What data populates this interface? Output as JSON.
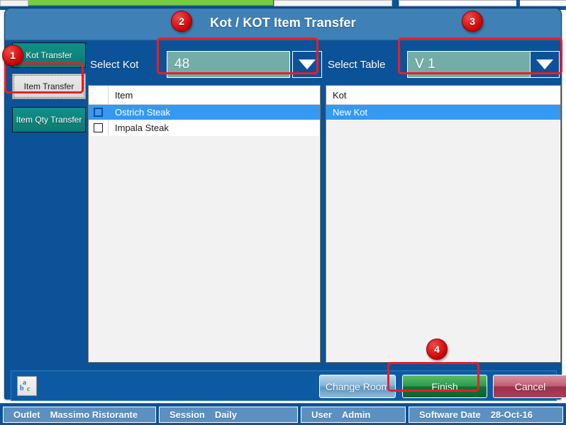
{
  "window": {
    "title": "Kot / KOT Item Transfer"
  },
  "sidebar": {
    "items": [
      {
        "label": "Kot Transfer",
        "state": "normal"
      },
      {
        "label": "Item Transfer",
        "state": "selected"
      },
      {
        "label": "Item Qty Transfer",
        "state": "normal"
      }
    ]
  },
  "fields": {
    "select_kot": {
      "label": "Select Kot",
      "value": "48",
      "dropdown_icon": "chevron-down-icon"
    },
    "select_table": {
      "label": "Select Table",
      "value": "V 1",
      "dropdown_icon": "chevron-down-icon"
    }
  },
  "item_list": {
    "header": "Item",
    "rows": [
      {
        "label": "Ostrich Steak",
        "checked": false,
        "selected": true
      },
      {
        "label": "Impala Steak",
        "checked": false,
        "selected": false
      }
    ]
  },
  "kot_list": {
    "header": "Kot",
    "rows": [
      {
        "label": "New Kot",
        "selected": true
      }
    ]
  },
  "toolbar": {
    "spellcheck_icon": "abc-spellcheck-icon",
    "icon_letters": {
      "a": "a",
      "b": "b",
      "c": "c"
    },
    "change_room_label": "Change Room",
    "finish_label": "Finish",
    "cancel_label": "Cancel"
  },
  "statusbar": {
    "cells": [
      {
        "key": "Outlet",
        "value": "Massimo Ristorante"
      },
      {
        "key": "Session",
        "value": "Daily"
      },
      {
        "key": "User",
        "value": "Admin"
      },
      {
        "key": "Software Date",
        "value": "28-Oct-16"
      }
    ]
  },
  "annotations": {
    "badges": [
      {
        "number": "1"
      },
      {
        "number": "2"
      },
      {
        "number": "3"
      },
      {
        "number": "4"
      }
    ],
    "highlight_color": "#ee1c23"
  },
  "colors": {
    "dialog_background": "#0c5298",
    "titlebar": "#3f80b7",
    "tab_teal": "#0f9189",
    "combo_value": "#74ada7",
    "row_selected": "#3399f3",
    "finish_green": "#0e7336",
    "cancel_red": "#9d2f4c",
    "statusbar_cell": "#5b90c1"
  }
}
